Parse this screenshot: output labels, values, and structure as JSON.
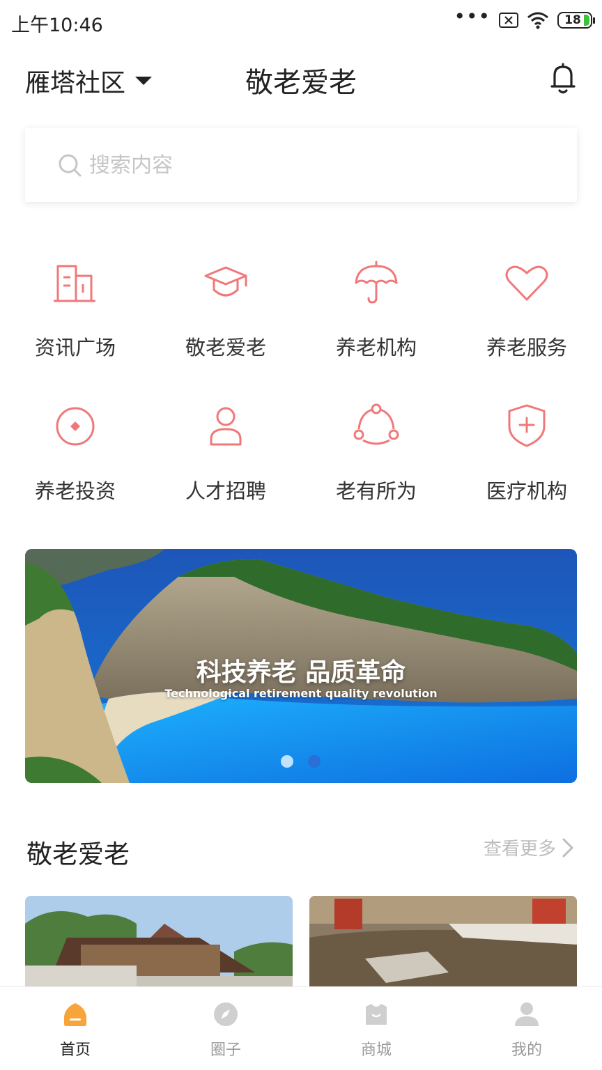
{
  "status_bar": {
    "time": "上午10:46",
    "dots": "•••",
    "battery": "18"
  },
  "header": {
    "community": "雁塔社区",
    "title": "敬老爱老"
  },
  "search": {
    "placeholder": "搜索内容"
  },
  "grid": [
    {
      "label": "资讯广场",
      "icon": "building-icon"
    },
    {
      "label": "敬老爱老",
      "icon": "graduation-cap-icon"
    },
    {
      "label": "养老机构",
      "icon": "umbrella-icon"
    },
    {
      "label": "养老服务",
      "icon": "heart-icon"
    },
    {
      "label": "养老投资",
      "icon": "compass-icon"
    },
    {
      "label": "人才招聘",
      "icon": "person-icon"
    },
    {
      "label": "老有所为",
      "icon": "share-nodes-icon"
    },
    {
      "label": "医疗机构",
      "icon": "shield-plus-icon"
    }
  ],
  "banner": {
    "title": "科技养老 品质革命",
    "subtitle": "Technological retirement quality revolution",
    "active_dot": 1,
    "dot_count": 2
  },
  "section": {
    "title": "敬老爱老",
    "more": "查看更多"
  },
  "tabs": [
    {
      "label": "首页",
      "icon": "home-icon",
      "active": true
    },
    {
      "label": "圈子",
      "icon": "compass-icon",
      "active": false
    },
    {
      "label": "商城",
      "icon": "shop-icon",
      "active": false
    },
    {
      "label": "我的",
      "icon": "user-icon",
      "active": false
    }
  ],
  "colors": {
    "accent": "#f0787a",
    "tab_active": "#f7a43a",
    "tab_inactive": "#cfcfcf"
  }
}
